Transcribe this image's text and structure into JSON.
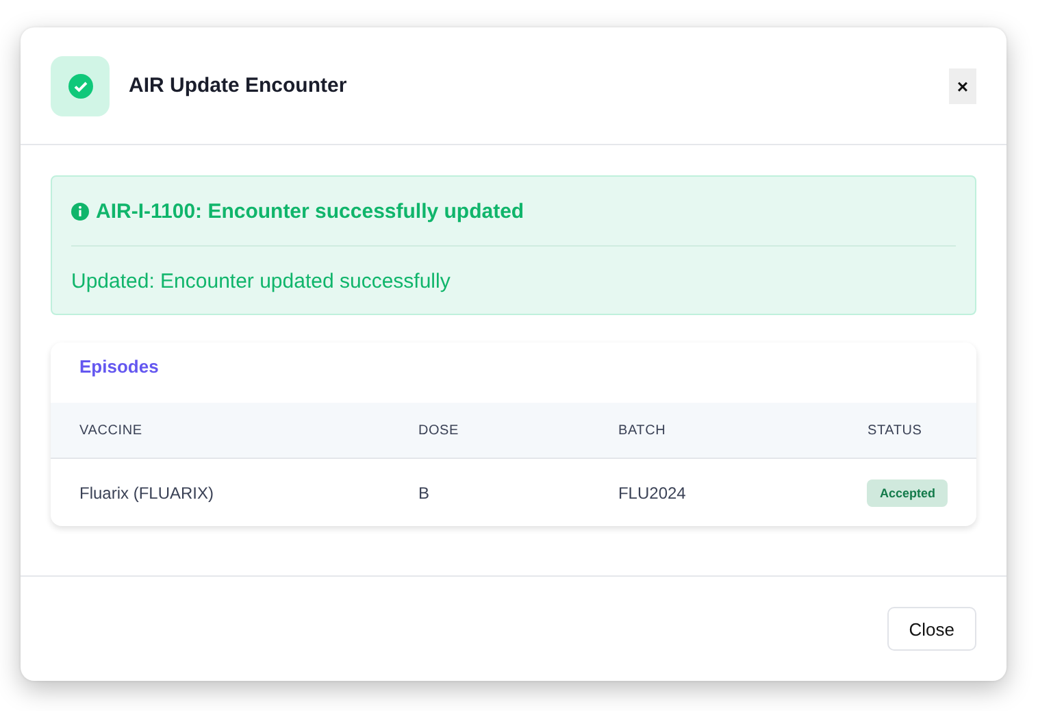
{
  "dialog": {
    "title": "AIR Update Encounter",
    "close_icon": "×"
  },
  "alert": {
    "title": "AIR-I-1100: Encounter successfully updated",
    "message": "Updated: Encounter updated successfully"
  },
  "episodes": {
    "title": "Episodes",
    "columns": [
      "VACCINE",
      "DOSE",
      "BATCH",
      "STATUS"
    ],
    "rows": [
      {
        "vaccine": "Fluarix (FLUARIX)",
        "dose": "B",
        "batch": "FLU2024",
        "status": "Accepted"
      }
    ]
  },
  "buttons": [
    "Close"
  ]
}
